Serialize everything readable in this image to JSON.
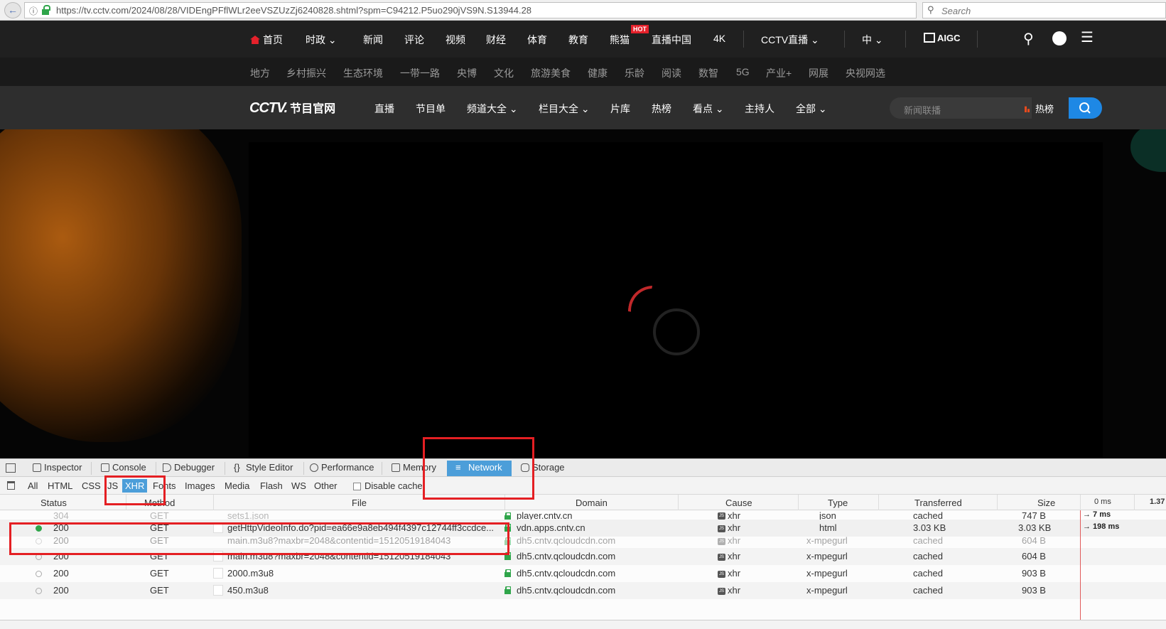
{
  "browser": {
    "url": "https://tv.cctv.com/2024/08/28/VIDEngPFflWLr2eeVSZUzZj6240828.shtml?spm=C94212.P5uo290jVS9N.S13944.28",
    "search_placeholder": "Search"
  },
  "site": {
    "top_nav": [
      "首页",
      "时政",
      "新闻",
      "评论",
      "视频",
      "财经",
      "体育",
      "教育",
      "熊猫",
      "直播中国",
      "4K",
      "CCTV直播",
      "中"
    ],
    "hot_badge": "HOT",
    "aigc_label": "AIGC",
    "sub_nav": [
      "地方",
      "乡村振兴",
      "生态环境",
      "一带一路",
      "央博",
      "文化",
      "旅游美食",
      "健康",
      "乐龄",
      "阅读",
      "数智",
      "5G",
      "产业+",
      "网展",
      "央视网选"
    ],
    "logo_main": "CCTV.",
    "logo_sub": "节目官网",
    "program_nav": [
      "直播",
      "节目单",
      "频道大全",
      "栏目大全",
      "片库",
      "热榜",
      "看点",
      "主持人",
      "全部"
    ],
    "search_placeholder": "新闻联播",
    "hot_rank": "热榜"
  },
  "devtools": {
    "tabs": [
      "Inspector",
      "Console",
      "Debugger",
      "Style Editor",
      "Performance",
      "Memory",
      "Network",
      "Storage"
    ],
    "active_tab": "Network",
    "filters": [
      "All",
      "HTML",
      "CSS",
      "JS",
      "XHR",
      "Fonts",
      "Images",
      "Media",
      "Flash",
      "WS",
      "Other"
    ],
    "active_filter": "XHR",
    "disable_cache": "Disable cache",
    "columns": [
      "Status",
      "Method",
      "File",
      "Domain",
      "Cause",
      "Type",
      "Transferred",
      "Size",
      "0 ms",
      "1.37"
    ],
    "rows": [
      {
        "status": "304",
        "method": "GET",
        "file": "sets1.json",
        "domain": "player.cntv.cn",
        "cause": "xhr",
        "type": "json",
        "transferred": "cached",
        "size": "747 B",
        "timing": "→ 7 ms"
      },
      {
        "status": "200",
        "method": "GET",
        "file": "getHttpVideoInfo.do?pid=ea66e9a8eb494f4397c12744ff3ccdce...",
        "domain": "vdn.apps.cntv.cn",
        "cause": "xhr",
        "type": "html",
        "transferred": "3.03 KB",
        "size": "3.03 KB",
        "timing": "→ 198 ms"
      },
      {
        "status": "200",
        "method": "GET",
        "file": "main.m3u8?maxbr=2048&contentid=15120519184043",
        "domain": "dh5.cntv.qcloudcdn.com",
        "cause": "xhr",
        "type": "x-mpegurl",
        "transferred": "cached",
        "size": "604 B",
        "timing": ""
      },
      {
        "status": "200",
        "method": "GET",
        "file": "main.m3u8?maxbr=2048&contentid=15120519184043",
        "domain": "dh5.cntv.qcloudcdn.com",
        "cause": "xhr",
        "type": "x-mpegurl",
        "transferred": "cached",
        "size": "604 B",
        "timing": ""
      },
      {
        "status": "200",
        "method": "GET",
        "file": "2000.m3u8",
        "domain": "dh5.cntv.qcloudcdn.com",
        "cause": "xhr",
        "type": "x-mpegurl",
        "transferred": "cached",
        "size": "903 B",
        "timing": ""
      },
      {
        "status": "200",
        "method": "GET",
        "file": "450.m3u8",
        "domain": "dh5.cntv.qcloudcdn.com",
        "cause": "xhr",
        "type": "x-mpegurl",
        "transferred": "cached",
        "size": "903 B",
        "timing": ""
      }
    ]
  },
  "colors": {
    "annotation": "#e41f23",
    "accent": "#4c9ed9",
    "brand_red": "#e5212b"
  }
}
